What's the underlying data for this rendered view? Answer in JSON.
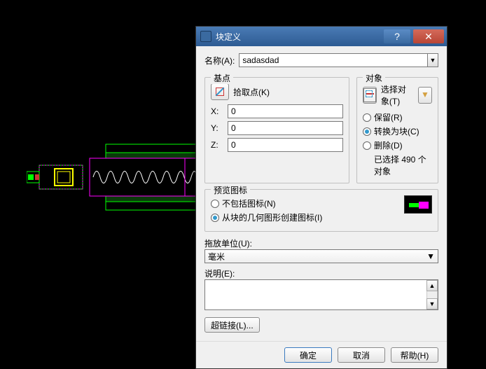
{
  "dialog": {
    "title": "块定义",
    "name_label": "名称(A):",
    "name_value": "sadasdad",
    "basepoint": {
      "legend": "基点",
      "pick_label": "拾取点(K)",
      "x_label": "X:",
      "x_value": "0",
      "y_label": "Y:",
      "y_value": "0",
      "z_label": "Z:",
      "z_value": "0"
    },
    "objects": {
      "legend": "对象",
      "select_label": "选择对象(T)",
      "retain": "保留(R)",
      "convert": "转换为块(C)",
      "delete": "删除(D)",
      "status": "已选择 490 个对象"
    },
    "preview": {
      "legend": "预览图标",
      "none": "不包括图标(N)",
      "create": "从块的几何图形创建图标(I)"
    },
    "units": {
      "label": "拖放单位(U):",
      "value": "毫米"
    },
    "description": {
      "label": "说明(E):"
    },
    "hyperlink": "超链接(L)...",
    "buttons": {
      "ok": "确定",
      "cancel": "取消",
      "help": "帮助(H)"
    }
  }
}
